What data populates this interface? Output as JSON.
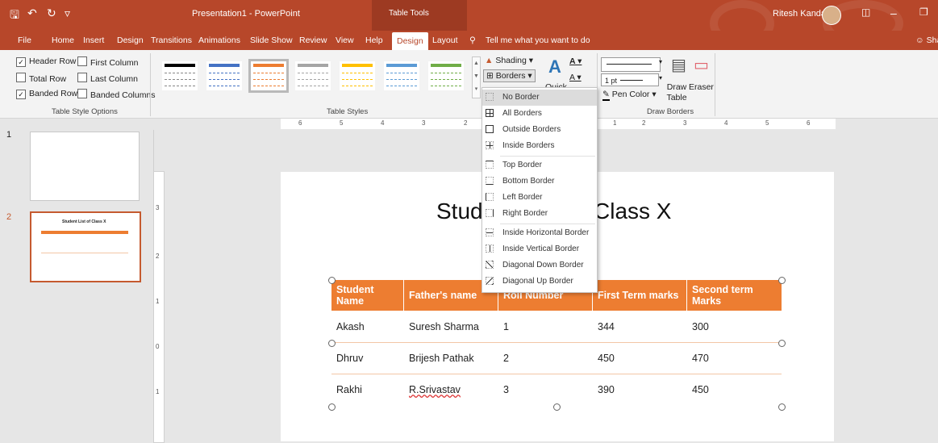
{
  "title_bar": {
    "doc_title": "Presentation1  -  PowerPoint",
    "context_tools": "Table Tools",
    "user": "Ritesh Kandari",
    "qa_icons": [
      "save-icon",
      "undo-icon",
      "redo-icon",
      "customize-icon"
    ]
  },
  "tabs": [
    "File",
    "Home",
    "Insert",
    "Design",
    "Transitions",
    "Animations",
    "Slide Show",
    "Review",
    "View",
    "Help",
    "Design",
    "Layout"
  ],
  "active_tab": "Design",
  "tell_me": "Tell me what you want to do",
  "share": "Share",
  "ribbon": {
    "style_options": {
      "items": [
        {
          "label": "Header Row",
          "checked": true
        },
        {
          "label": "First Column",
          "checked": false
        },
        {
          "label": "Total Row",
          "checked": false
        },
        {
          "label": "Last Column",
          "checked": false
        },
        {
          "label": "Banded Rows",
          "checked": true
        },
        {
          "label": "Banded Columns",
          "checked": false
        }
      ],
      "group_label": "Table Style Options"
    },
    "table_styles": {
      "group_label": "Table Styles",
      "header_colors": [
        "#000000",
        "#4472c4",
        "#ed7d31",
        "#a5a5a5",
        "#ffc000",
        "#5b9bd5",
        "#70ad47"
      ]
    },
    "shading": "Shading",
    "borders": "Borders",
    "quick": "Quick",
    "pen_weight": "1 pt",
    "pen_color": "Pen Color",
    "draw_table": "Draw Table",
    "eraser": "Eraser",
    "draw_borders_label": "Draw Borders"
  },
  "slides": [
    {
      "num": "1"
    },
    {
      "num": "2",
      "mini_title": "Student List of Class X"
    }
  ],
  "ruler": {
    "h": [
      "6",
      "5",
      "4",
      "3",
      "2",
      "1",
      "2",
      "3",
      "4",
      "5",
      "6"
    ],
    "v": [
      "3",
      "2",
      "1",
      "0",
      "1"
    ]
  },
  "slide": {
    "title": "Stud",
    "title_end": "Class X",
    "table": {
      "headers": [
        "Student Name",
        "Father's name",
        "Roll Number",
        "First Term marks",
        "Second term Marks"
      ],
      "rows": [
        [
          "Akash",
          "Suresh Sharma",
          "1",
          "344",
          "300"
        ],
        [
          "Dhruv",
          "Brijesh Pathak",
          "2",
          "450",
          "470"
        ],
        [
          "Rakhi",
          "R.Srivastav",
          "3",
          "390",
          "450"
        ]
      ]
    }
  },
  "borders_menu": [
    {
      "label": "No Border",
      "icon": "no-border-icon"
    },
    {
      "label": "All Borders",
      "icon": "all-borders-icon"
    },
    {
      "label": "Outside Borders",
      "icon": "outside-borders-icon"
    },
    {
      "label": "Inside Borders",
      "icon": "inside-borders-icon"
    },
    {
      "label": "Top Border",
      "icon": "top-border-icon"
    },
    {
      "label": "Bottom Border",
      "icon": "bottom-border-icon"
    },
    {
      "label": "Left Border",
      "icon": "left-border-icon"
    },
    {
      "label": "Right Border",
      "icon": "right-border-icon"
    },
    {
      "label": "Inside Horizontal Border",
      "icon": "inside-horizontal-border-icon"
    },
    {
      "label": "Inside Vertical Border",
      "icon": "inside-vertical-border-icon"
    },
    {
      "label": "Diagonal Down Border",
      "icon": "diagonal-down-border-icon"
    },
    {
      "label": "Diagonal Up Border",
      "icon": "diagonal-up-border-icon"
    }
  ]
}
